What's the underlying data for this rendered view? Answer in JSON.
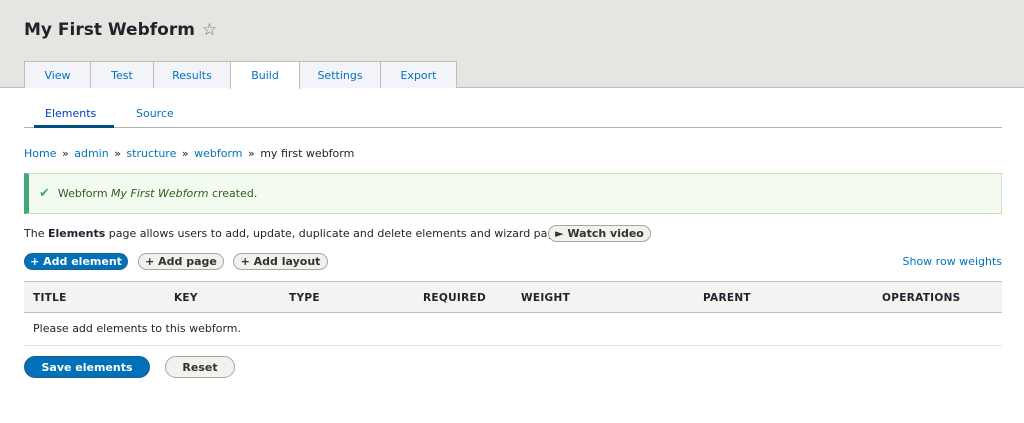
{
  "header": {
    "title": "My First Webform",
    "star_icon": "☆"
  },
  "tabs": [
    {
      "label": "View",
      "active": false
    },
    {
      "label": "Test",
      "active": false
    },
    {
      "label": "Results",
      "active": false
    },
    {
      "label": "Build",
      "active": true
    },
    {
      "label": "Settings",
      "active": false
    },
    {
      "label": "Export",
      "active": false
    }
  ],
  "subtabs": [
    {
      "label": "Elements",
      "active": true
    },
    {
      "label": "Source",
      "active": false
    }
  ],
  "breadcrumb": {
    "items": [
      "Home",
      "admin",
      "structure",
      "webform"
    ],
    "current": "my first webform",
    "separator": "»"
  },
  "message": {
    "prefix": "Webform ",
    "name": "My First Webform",
    "suffix": " created.",
    "check_icon": "✔"
  },
  "description": {
    "prefix": "The ",
    "strong": "Elements",
    "suffix": " page allows users to add, update, duplicate and delete elements and wizard pages."
  },
  "buttons": {
    "watch_video": "► Watch video",
    "add_element": "+ Add element",
    "add_page": "+ Add page",
    "add_layout": "+ Add layout",
    "save_elements": "Save elements",
    "reset": "Reset"
  },
  "show_row_weights": "Show row weights",
  "table": {
    "columns": [
      "TITLE",
      "KEY",
      "TYPE",
      "REQUIRED",
      "WEIGHT",
      "PARENT",
      "OPERATIONS"
    ],
    "empty_message": "Please add elements to this webform."
  },
  "colors": {
    "primary": "#0071b8",
    "link": "#0074bd",
    "success": "#42a877"
  }
}
